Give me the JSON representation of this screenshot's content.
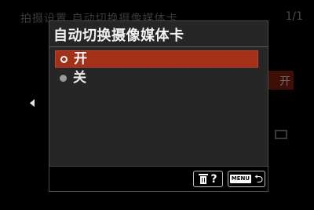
{
  "background": {
    "title": "拍摄设置 自动切换摄像媒体卡",
    "page_indicator": "1/1",
    "current_value": "开"
  },
  "dialog": {
    "title": "自动切换摄像媒体卡",
    "options": [
      {
        "label": "开",
        "selected": true
      },
      {
        "label": "关",
        "selected": false
      }
    ]
  },
  "footer": {
    "help_label": "?",
    "menu_label": "MENU",
    "return_symbol": "⮌"
  },
  "icons": {
    "left_arrow": "left-triangle-icon",
    "delete": "trash-icon",
    "back": "return-icon",
    "radio_selected": "radio-selected-icon",
    "radio_unselected": "radio-unselected-icon"
  },
  "colors": {
    "highlight": "#a5301a",
    "dialog_bg": "#262626",
    "screen_bg": "#000000"
  }
}
